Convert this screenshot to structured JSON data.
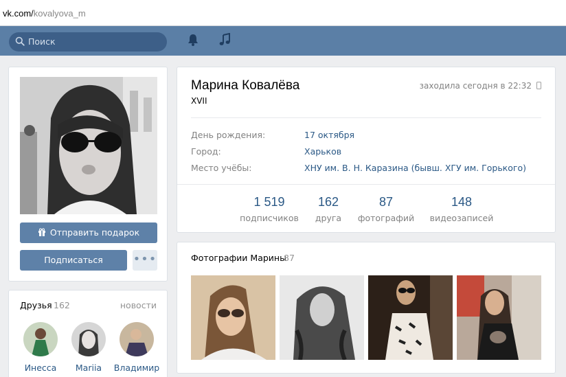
{
  "browser": {
    "url_host": "vk.com/",
    "url_path": "kovalyova_m"
  },
  "header": {
    "search_placeholder": "Поиск",
    "icons": [
      "search-icon",
      "bell-icon",
      "music-icon"
    ],
    "accent_color": "#5b7fa6"
  },
  "profile_photo": {
    "buttons": {
      "gift_label": "Отправить подарок",
      "subscribe_label": "Подписаться",
      "more_label": "•••"
    }
  },
  "friends": {
    "title": "Друзья",
    "count": "162",
    "news_link": "новости",
    "items": [
      {
        "name": "Инесса"
      },
      {
        "name": "Mariia"
      },
      {
        "name": "Владимир"
      }
    ]
  },
  "profile": {
    "name": "Марина Ковалёва",
    "status": "XVII",
    "last_seen": "заходила сегодня в 22:32",
    "info": [
      {
        "label": "День рождения:",
        "value": "17 октября"
      },
      {
        "label": "Город:",
        "value": "Харьков"
      },
      {
        "label": "Место учёбы:",
        "value": "ХНУ им. В. Н. Каразина (бывш. ХГУ им. Горького)"
      }
    ],
    "counters": [
      {
        "number": "1 519",
        "label": "подписчиков"
      },
      {
        "number": "162",
        "label": "друга"
      },
      {
        "number": "87",
        "label": "фотографий"
      },
      {
        "number": "148",
        "label": "видеозаписей"
      }
    ]
  },
  "photos": {
    "title": "Фотографии Марины",
    "count": "87"
  }
}
